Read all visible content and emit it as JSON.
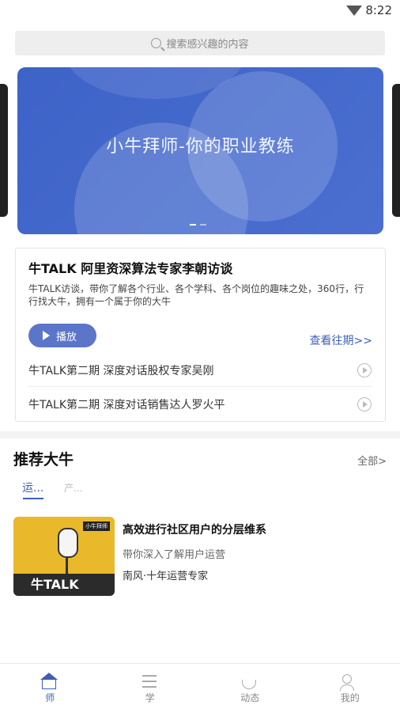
{
  "status_bar": {
    "time": "8:22"
  },
  "search": {
    "placeholder": "搜索感兴趣的内容"
  },
  "banner": {
    "title": "小牛拜师-你的职业教练"
  },
  "talk": {
    "title": "牛TALK 阿里资深算法专家李朝访谈",
    "description": "牛TALK访谈，带你了解各个行业、各个学科、各个岗位的趣味之处，360行，行行找大牛，拥有一个属于你的大牛",
    "play_label": "播放",
    "history_label": "查看往期>>",
    "episodes": [
      {
        "title": "牛TALK第二期 深度对话股权专家吴刚"
      },
      {
        "title": "牛TALK第二期 深度对话销售达人罗火平"
      }
    ]
  },
  "recommend": {
    "title": "推荐大牛",
    "all_label": "全部>",
    "tabs": [
      {
        "label": "运..."
      },
      {
        "label": "产..."
      }
    ],
    "course": {
      "thumb_text": "牛TALK",
      "thumb_tag": "小牛拜师",
      "title": "高效进行社区用户的分层维系",
      "subtitle": "带你深入了解用户运营",
      "author": "南风·十年运营专家"
    }
  },
  "tabbar": [
    {
      "label": "师",
      "icon": "home-icon",
      "active": true
    },
    {
      "label": "学",
      "icon": "learn-icon",
      "active": false
    },
    {
      "label": "动态",
      "icon": "dynamic-icon",
      "active": false
    },
    {
      "label": "我的",
      "icon": "profile-icon",
      "active": false
    }
  ],
  "colors": {
    "accent": "#3e5fb8",
    "banner": "#4a6fd0",
    "thumb": "#e9b92b"
  }
}
